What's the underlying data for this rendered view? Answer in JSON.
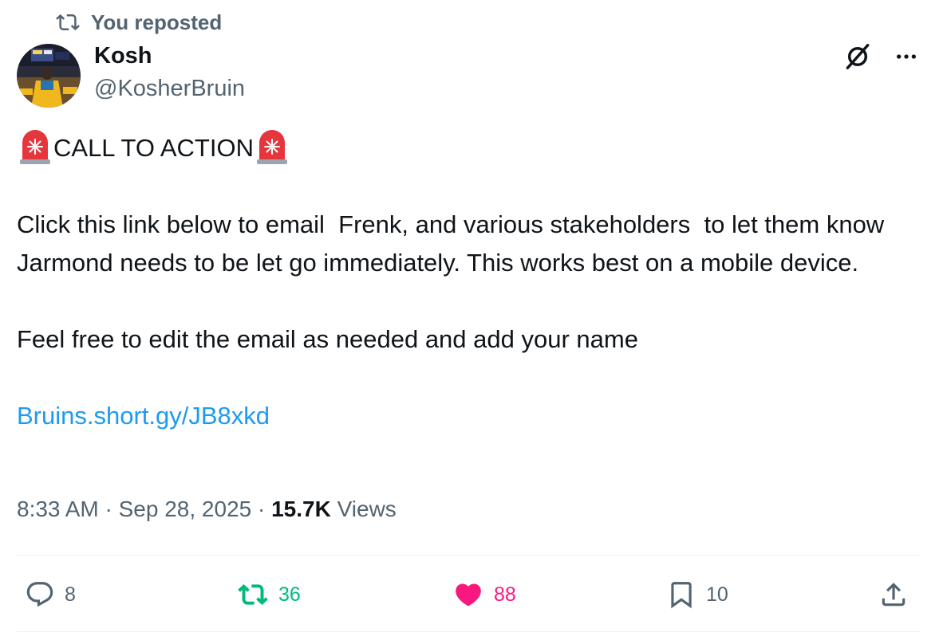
{
  "repost_banner": {
    "text": "You reposted",
    "icon": "repost-icon"
  },
  "author": {
    "display_name": "Kosh",
    "handle": "@KosherBruin",
    "avatar_icon": "avatar"
  },
  "header_icons": {
    "grok": "slashed-circle-icon",
    "more": "more-icon"
  },
  "tweet": {
    "call_to_action": "CALL TO ACTION",
    "siren_icon": "rotating-light-emoji",
    "paragraph_1": "Click this link below to email  Frenk, and various stakeholders  to let them know Jarmond needs to be let go immediately. This works best on a mobile device.",
    "paragraph_2": "Feel free to edit the email as needed and add your name",
    "link": "Bruins.short.gy/JB8xkd"
  },
  "meta": {
    "time": "8:33 AM",
    "sep": "·",
    "date": "Sep 28, 2025",
    "views_count": "15.7K",
    "views_label": "Views"
  },
  "actions": {
    "replies": "8",
    "reposts": "36",
    "likes": "88",
    "bookmarks": "10"
  },
  "colors": {
    "text": "#0f1419",
    "secondary": "#536471",
    "link": "#1d9bf0",
    "repost_active": "#00ba7c",
    "like_active": "#f91880",
    "divider": "#eff3f4"
  }
}
